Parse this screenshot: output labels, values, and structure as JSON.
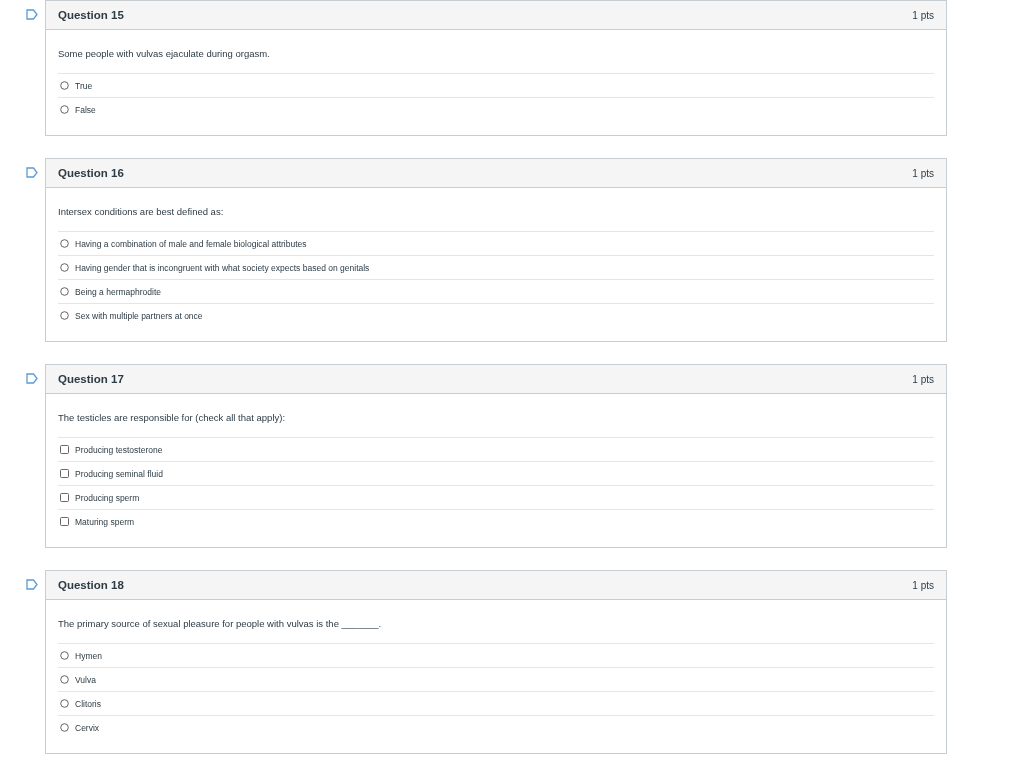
{
  "questions": [
    {
      "title": "Question 15",
      "points": "1 pts",
      "text": "Some people with vulvas ejaculate during orgasm.",
      "kind": "radio",
      "answers": [
        {
          "label": "True",
          "selected": false
        },
        {
          "label": "False",
          "selected": false
        }
      ]
    },
    {
      "title": "Question 16",
      "points": "1 pts",
      "text": "Intersex conditions are best defined as:",
      "kind": "radio",
      "answers": [
        {
          "label": "Having a combination of male and female biological attributes",
          "selected": false
        },
        {
          "label": "Having gender that is incongruent with what society expects based on genitals",
          "selected": false
        },
        {
          "label": "Being a hermaphrodite",
          "selected": false
        },
        {
          "label": "Sex with multiple partners at once",
          "selected": false
        }
      ]
    },
    {
      "title": "Question 17",
      "points": "1 pts",
      "text": "The testicles are responsible for (check all that apply):",
      "kind": "checkbox",
      "answers": [
        {
          "label": "Producing testosterone",
          "selected": false
        },
        {
          "label": "Producing seminal fluid",
          "selected": false
        },
        {
          "label": "Producing sperm",
          "selected": false
        },
        {
          "label": "Maturing sperm",
          "selected": false
        }
      ]
    },
    {
      "title": "Question 18",
      "points": "1 pts",
      "text": "The primary source of sexual pleasure for people with vulvas is the _______.",
      "kind": "radio",
      "answers": [
        {
          "label": "Hymen",
          "selected": false
        },
        {
          "label": "Vulva",
          "selected": false
        },
        {
          "label": "Clitoris",
          "selected": false
        },
        {
          "label": "Cervix",
          "selected": false
        }
      ]
    }
  ]
}
